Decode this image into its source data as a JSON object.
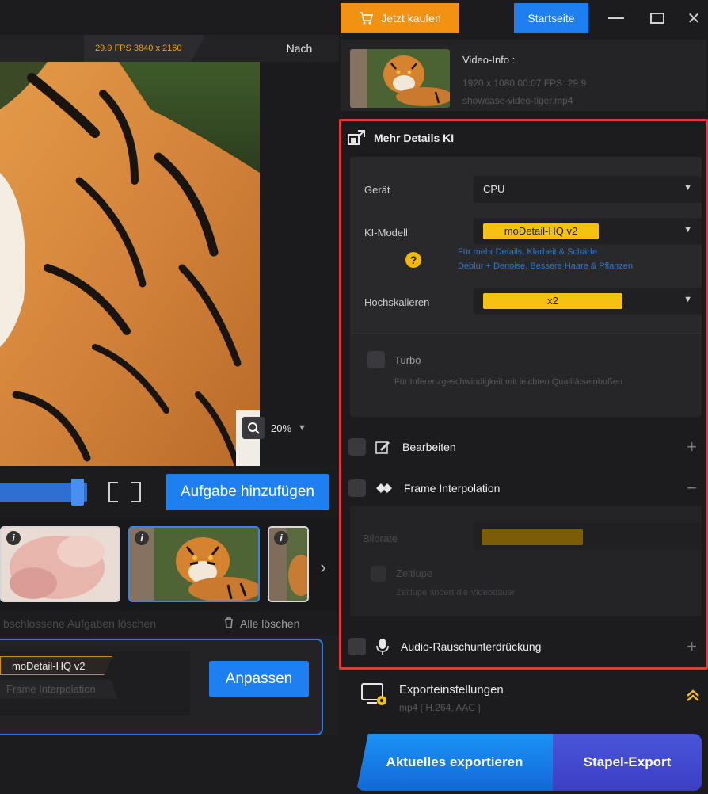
{
  "preview": {
    "fps_resolution": "29.9 FPS  3840 x 2160",
    "after_label": "Nach",
    "zoom_value": "20%"
  },
  "timeline": {
    "add_task_label": "Aufgabe hinzufügen"
  },
  "thumbnails": [
    {
      "name": "baby",
      "selected": false
    },
    {
      "name": "tiger",
      "selected": true
    },
    {
      "name": "partial",
      "selected": false
    }
  ],
  "task_actions": {
    "clear_done_label": "bschlossene Aufgaben löschen",
    "clear_all_label": "Alle löschen"
  },
  "task_card": {
    "chip_model": "moDetail-HQ  v2",
    "chip_interp": "Frame Interpolation",
    "adjust_label": "Anpassen"
  },
  "titlebar": {
    "buy_label": "Jetzt kaufen",
    "home_label": "Startseite",
    "close_glyph": "✕"
  },
  "video_info": {
    "title": "Video-Info :",
    "meta": "1920 x 1080  00:07  FPS: 29.9",
    "file": "showcase-video-tiger.mp4"
  },
  "ai_section": {
    "title": "Mehr Details KI",
    "device_label": "Gerät",
    "device_value": "CPU",
    "model_label": "KI-Modell",
    "model_value": "moDetail-HQ  v2",
    "model_hint_1": "Für mehr Details, Klarheit & Schärfe",
    "model_hint_2": "Deblur + Denoise, Bessere Haare & Pflanzen",
    "upscale_label": "Hochskalieren",
    "upscale_value": "x2",
    "turbo_label": "Turbo",
    "turbo_desc": "Für Inferenzgeschwindigkeit mit leichten Qualitätseinbußen"
  },
  "edit_section": {
    "title": "Bearbeiten",
    "plus": "+"
  },
  "frame_interp_section": {
    "title": "Frame Interpolation",
    "minus": "−",
    "rate_label": "Bildrate",
    "slowmo_label": "Zeitlupe",
    "slowmo_desc": "Zeitlupe ändert die Videodauer"
  },
  "audio_section": {
    "title": "Audio-Rauschunterdrückung",
    "plus": "+"
  },
  "export_settings": {
    "title": "Exporteinstellungen",
    "subtitle": "mp4 [ H.264, AAC ]"
  },
  "export_buttons": {
    "current_label": "Aktuelles exportieren",
    "batch_label": "Stapel-Export"
  },
  "colors": {
    "accent_blue": "#1e80f0",
    "buy_orange": "#f29112",
    "highlight_yellow": "#f5c211",
    "frame_red": "#e23a3a"
  }
}
